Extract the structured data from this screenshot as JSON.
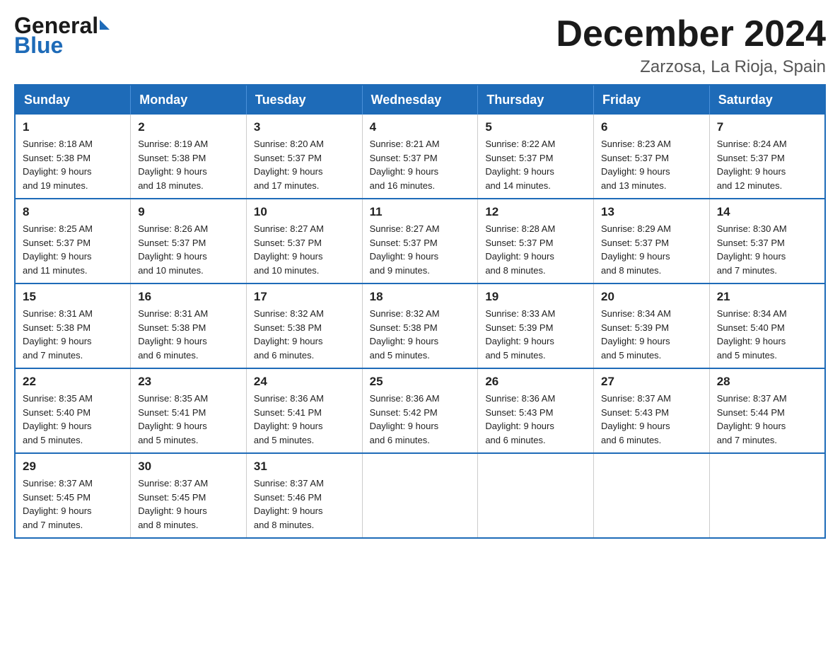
{
  "header": {
    "logo_general": "General",
    "logo_blue": "Blue",
    "month_title": "December 2024",
    "location": "Zarzosa, La Rioja, Spain"
  },
  "days_of_week": [
    "Sunday",
    "Monday",
    "Tuesday",
    "Wednesday",
    "Thursday",
    "Friday",
    "Saturday"
  ],
  "weeks": [
    [
      {
        "day": "1",
        "sunrise": "8:18 AM",
        "sunset": "5:38 PM",
        "daylight": "9 hours and 19 minutes."
      },
      {
        "day": "2",
        "sunrise": "8:19 AM",
        "sunset": "5:38 PM",
        "daylight": "9 hours and 18 minutes."
      },
      {
        "day": "3",
        "sunrise": "8:20 AM",
        "sunset": "5:37 PM",
        "daylight": "9 hours and 17 minutes."
      },
      {
        "day": "4",
        "sunrise": "8:21 AM",
        "sunset": "5:37 PM",
        "daylight": "9 hours and 16 minutes."
      },
      {
        "day": "5",
        "sunrise": "8:22 AM",
        "sunset": "5:37 PM",
        "daylight": "9 hours and 14 minutes."
      },
      {
        "day": "6",
        "sunrise": "8:23 AM",
        "sunset": "5:37 PM",
        "daylight": "9 hours and 13 minutes."
      },
      {
        "day": "7",
        "sunrise": "8:24 AM",
        "sunset": "5:37 PM",
        "daylight": "9 hours and 12 minutes."
      }
    ],
    [
      {
        "day": "8",
        "sunrise": "8:25 AM",
        "sunset": "5:37 PM",
        "daylight": "9 hours and 11 minutes."
      },
      {
        "day": "9",
        "sunrise": "8:26 AM",
        "sunset": "5:37 PM",
        "daylight": "9 hours and 10 minutes."
      },
      {
        "day": "10",
        "sunrise": "8:27 AM",
        "sunset": "5:37 PM",
        "daylight": "9 hours and 10 minutes."
      },
      {
        "day": "11",
        "sunrise": "8:27 AM",
        "sunset": "5:37 PM",
        "daylight": "9 hours and 9 minutes."
      },
      {
        "day": "12",
        "sunrise": "8:28 AM",
        "sunset": "5:37 PM",
        "daylight": "9 hours and 8 minutes."
      },
      {
        "day": "13",
        "sunrise": "8:29 AM",
        "sunset": "5:37 PM",
        "daylight": "9 hours and 8 minutes."
      },
      {
        "day": "14",
        "sunrise": "8:30 AM",
        "sunset": "5:37 PM",
        "daylight": "9 hours and 7 minutes."
      }
    ],
    [
      {
        "day": "15",
        "sunrise": "8:31 AM",
        "sunset": "5:38 PM",
        "daylight": "9 hours and 7 minutes."
      },
      {
        "day": "16",
        "sunrise": "8:31 AM",
        "sunset": "5:38 PM",
        "daylight": "9 hours and 6 minutes."
      },
      {
        "day": "17",
        "sunrise": "8:32 AM",
        "sunset": "5:38 PM",
        "daylight": "9 hours and 6 minutes."
      },
      {
        "day": "18",
        "sunrise": "8:32 AM",
        "sunset": "5:38 PM",
        "daylight": "9 hours and 5 minutes."
      },
      {
        "day": "19",
        "sunrise": "8:33 AM",
        "sunset": "5:39 PM",
        "daylight": "9 hours and 5 minutes."
      },
      {
        "day": "20",
        "sunrise": "8:34 AM",
        "sunset": "5:39 PM",
        "daylight": "9 hours and 5 minutes."
      },
      {
        "day": "21",
        "sunrise": "8:34 AM",
        "sunset": "5:40 PM",
        "daylight": "9 hours and 5 minutes."
      }
    ],
    [
      {
        "day": "22",
        "sunrise": "8:35 AM",
        "sunset": "5:40 PM",
        "daylight": "9 hours and 5 minutes."
      },
      {
        "day": "23",
        "sunrise": "8:35 AM",
        "sunset": "5:41 PM",
        "daylight": "9 hours and 5 minutes."
      },
      {
        "day": "24",
        "sunrise": "8:36 AM",
        "sunset": "5:41 PM",
        "daylight": "9 hours and 5 minutes."
      },
      {
        "day": "25",
        "sunrise": "8:36 AM",
        "sunset": "5:42 PM",
        "daylight": "9 hours and 6 minutes."
      },
      {
        "day": "26",
        "sunrise": "8:36 AM",
        "sunset": "5:43 PM",
        "daylight": "9 hours and 6 minutes."
      },
      {
        "day": "27",
        "sunrise": "8:37 AM",
        "sunset": "5:43 PM",
        "daylight": "9 hours and 6 minutes."
      },
      {
        "day": "28",
        "sunrise": "8:37 AM",
        "sunset": "5:44 PM",
        "daylight": "9 hours and 7 minutes."
      }
    ],
    [
      {
        "day": "29",
        "sunrise": "8:37 AM",
        "sunset": "5:45 PM",
        "daylight": "9 hours and 7 minutes."
      },
      {
        "day": "30",
        "sunrise": "8:37 AM",
        "sunset": "5:45 PM",
        "daylight": "9 hours and 8 minutes."
      },
      {
        "day": "31",
        "sunrise": "8:37 AM",
        "sunset": "5:46 PM",
        "daylight": "9 hours and 8 minutes."
      },
      null,
      null,
      null,
      null
    ]
  ],
  "labels": {
    "sunrise": "Sunrise:",
    "sunset": "Sunset:",
    "daylight": "Daylight:"
  },
  "colors": {
    "header_bg": "#1e6bb8",
    "header_text": "#ffffff",
    "border": "#1e6bb8"
  }
}
